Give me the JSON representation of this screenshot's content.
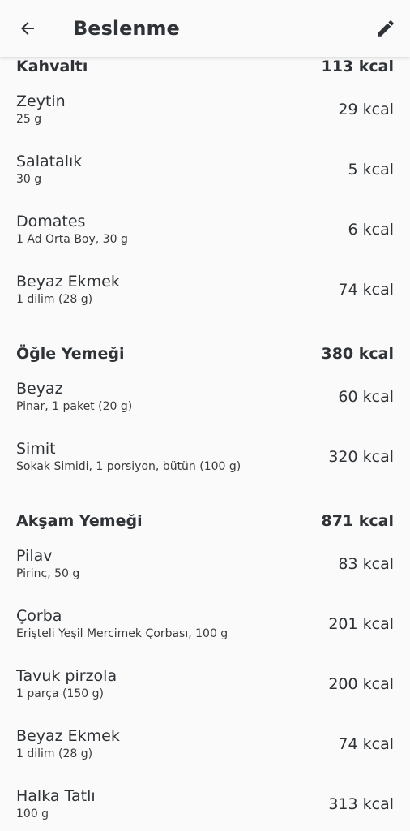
{
  "header": {
    "title": "Beslenme"
  },
  "icons": {
    "back": "arrow-left-icon",
    "edit": "pencil-icon"
  },
  "sections": [
    {
      "title": "Kahvaltı",
      "total": "113 kcal",
      "items": [
        {
          "name": "Zeytin",
          "detail": "25 g",
          "kcal": "29 kcal"
        },
        {
          "name": "Salatalık",
          "detail": "30 g",
          "kcal": "5 kcal"
        },
        {
          "name": "Domates",
          "detail": "1 Ad Orta Boy, 30 g",
          "kcal": "6 kcal"
        },
        {
          "name": "Beyaz Ekmek",
          "detail": "1 dilim (28 g)",
          "kcal": "74 kcal"
        }
      ]
    },
    {
      "title": "Öğle Yemeği",
      "total": "380 kcal",
      "items": [
        {
          "name": "Beyaz",
          "detail": "Pinar, 1 paket (20 g)",
          "kcal": "60 kcal"
        },
        {
          "name": "Simit",
          "detail": "Sokak Simidi, 1 porsiyon, bütün (100 g)",
          "kcal": "320 kcal"
        }
      ]
    },
    {
      "title": "Akşam Yemeği",
      "total": "871 kcal",
      "items": [
        {
          "name": "Pilav",
          "detail": "Pirinç, 50 g",
          "kcal": "83 kcal"
        },
        {
          "name": "Çorba",
          "detail": "Erişteli Yeşil Mercimek Çorbası, 100 g",
          "kcal": "201 kcal"
        },
        {
          "name": "Tavuk pirzola",
          "detail": "1 parça (150 g)",
          "kcal": "200 kcal"
        },
        {
          "name": "Beyaz Ekmek",
          "detail": "1 dilim (28 g)",
          "kcal": "74 kcal"
        },
        {
          "name": "Halka Tatlı",
          "detail": "100 g",
          "kcal": "313 kcal"
        }
      ]
    }
  ]
}
